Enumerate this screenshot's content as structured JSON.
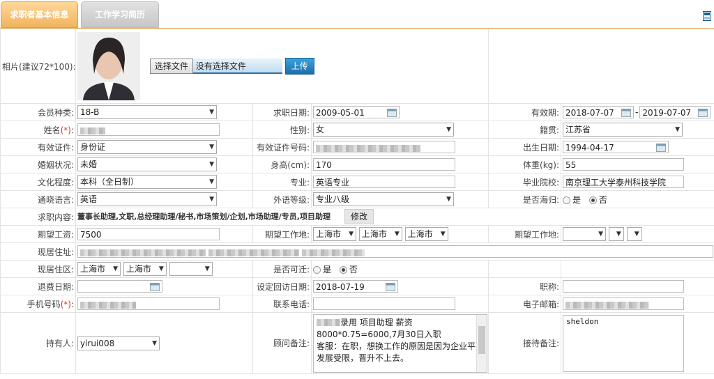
{
  "tabs": {
    "active": "求职者基本信息",
    "inactive": "工作学习简历"
  },
  "photo": {
    "label": "相片(建议72*100):",
    "file_button": "选择文件",
    "file_status": "没有选择文件",
    "upload": "上传"
  },
  "rows": {
    "member_type": {
      "label": "会员种类:",
      "value": "18-B"
    },
    "job_date": {
      "label": "求职日期:",
      "value": "2009-05-01"
    },
    "valid_period": {
      "label": "有效期:",
      "from": "2018-07-07",
      "sep": "-",
      "to": "2019-07-07"
    },
    "name": {
      "label": "姓名",
      "req": "(*)",
      "colon": ":"
    },
    "gender": {
      "label": "性别:",
      "value": "女"
    },
    "native": {
      "label": "籍贯:",
      "value": "江苏省"
    },
    "id_type": {
      "label": "有效证件:",
      "value": "身份证"
    },
    "id_number": {
      "label": "有效证件号码:"
    },
    "birth": {
      "label": "出生日期:",
      "value": "1994-04-17"
    },
    "marital": {
      "label": "婚姻状况:",
      "value": "未婚"
    },
    "height": {
      "label": "身高(cm):",
      "value": "170"
    },
    "weight": {
      "label": "体重(kg):",
      "value": "55"
    },
    "education": {
      "label": "文化程度:",
      "value": "本科（全日制）"
    },
    "major": {
      "label": "专业:",
      "value": "英语专业"
    },
    "school": {
      "label": "毕业院校:",
      "value": "南京理工大学泰州科技学院"
    },
    "language": {
      "label": "通晓语言:",
      "value": "英语"
    },
    "lang_level": {
      "label": "外语等级:",
      "value": "专业八级"
    },
    "returnee": {
      "label": "是否海归:",
      "yes": "是",
      "no": "否"
    },
    "job_content": {
      "label": "求职内容:",
      "value": "董事长助理,文职,总经理助理/秘书,市场策划/企划,市场助理/专员,项目助理",
      "edit": "修改"
    },
    "salary": {
      "label": "期望工资:",
      "value": "7500"
    },
    "work_place1": {
      "label": "期望工作地:",
      "a": "上海市",
      "b": "上海市",
      "c": "上海市"
    },
    "work_place2": {
      "label": "期望工作地:"
    },
    "address": {
      "label": "现居住址:"
    },
    "district": {
      "label": "现居住区:",
      "a": "上海市",
      "b": "上海市"
    },
    "relocate": {
      "label": "是否可迁:",
      "yes": "是",
      "no": "否"
    },
    "refund_date": {
      "label": "退费日期:"
    },
    "callback_date": {
      "label": "设定回访日期:",
      "value": "2018-07-19"
    },
    "title": {
      "label": "职称:"
    },
    "mobile": {
      "label": "手机号码",
      "req": "(*)",
      "colon": ":"
    },
    "phone": {
      "label": "联系电话:"
    },
    "email": {
      "label": "电子邮箱:"
    },
    "holder": {
      "label": "持有人:",
      "value": "yirui008"
    },
    "consultant_note": {
      "label": "顾问备注:",
      "line1": "录用 项目助理   薪资",
      "line2": "8000*0.75=6000,7月30日入职",
      "line3": "客服：在职，想换工作的原因是因为企业平台发展受限，晋升不上去。"
    },
    "reception_note": {
      "label": "接待备注:",
      "value": "sheldon"
    }
  }
}
